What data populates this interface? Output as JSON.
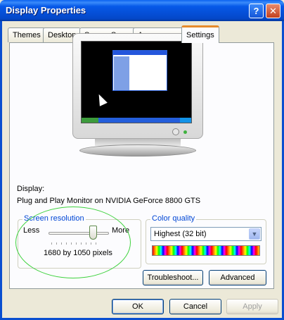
{
  "window": {
    "title": "Display Properties"
  },
  "title_buttons": {
    "help": "?",
    "close": "✕"
  },
  "tabs": [
    {
      "label": "Themes"
    },
    {
      "label": "Desktop"
    },
    {
      "label": "Screen Saver"
    },
    {
      "label": "Appearance"
    },
    {
      "label": "Settings",
      "active": true
    }
  ],
  "display": {
    "caption": "Display:",
    "device": "Plug and Play Monitor on NVIDIA GeForce 8800 GTS"
  },
  "screen_resolution": {
    "group_label": "Screen resolution",
    "less_label": "Less",
    "more_label": "More",
    "value_text": "1680 by 1050 pixels",
    "slider_level": 0.82
  },
  "color_quality": {
    "group_label": "Color quality",
    "selected": "Highest (32 bit)"
  },
  "buttons": {
    "troubleshoot": "Troubleshoot...",
    "advanced": "Advanced",
    "ok": "OK",
    "cancel": "Cancel",
    "apply": "Apply"
  },
  "colors": {
    "titlebar": "#0553e0",
    "active_tab_accent": "#e68b2c",
    "group_label": "#0046d5",
    "highlight_ellipse": "#3ed23e"
  },
  "icons": {
    "help": "help-icon",
    "close": "close-icon",
    "dropdown": "chevron-down-icon"
  }
}
